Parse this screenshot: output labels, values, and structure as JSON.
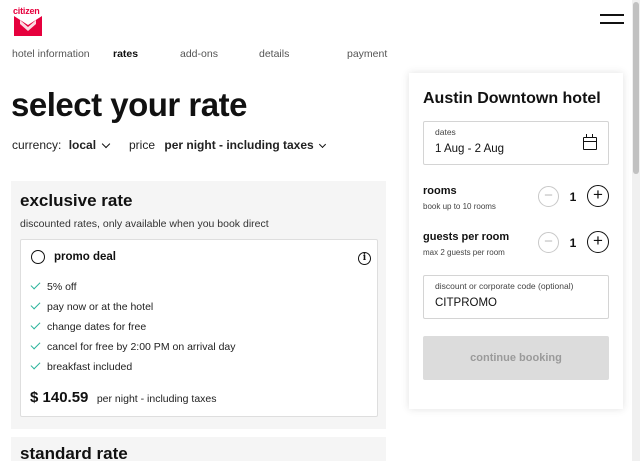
{
  "brand": {
    "logo_text": "citizen",
    "accent": "#e6003d"
  },
  "nav": {
    "steps": [
      {
        "label": "hotel information"
      },
      {
        "label": "rates",
        "active": true
      },
      {
        "label": "add-ons"
      },
      {
        "label": "details"
      },
      {
        "label": "payment"
      }
    ],
    "menu_icon": "hamburger-icon"
  },
  "page": {
    "title": "select your rate"
  },
  "filters": {
    "currency": {
      "label": "currency:",
      "value": "local"
    },
    "price": {
      "label": "price",
      "value": "per night - including taxes"
    }
  },
  "rates": [
    {
      "title": "exclusive rate",
      "subtitle": "discounted rates, only available when you book direct",
      "deal": {
        "name": "promo deal",
        "features": [
          "5% off",
          "pay now or at the hotel",
          "change dates for free",
          "cancel for free by 2:00 PM on arrival day",
          "breakfast included"
        ],
        "price": "$ 140.59",
        "price_note": "per night - including taxes",
        "check_color": "#2bb39b"
      }
    },
    {
      "title": "standard rate"
    }
  ],
  "booking": {
    "hotel_name": "Austin Downtown hotel",
    "dates": {
      "label": "dates",
      "value": "1 Aug - 2 Aug"
    },
    "rooms": {
      "label": "rooms",
      "sub": "book up to 10 rooms",
      "value": "1"
    },
    "guests": {
      "label": "guests per room",
      "sub": "max 2 guests per room",
      "value": "1"
    },
    "code": {
      "label": "discount or corporate code (optional)",
      "value": "CITPROMO"
    },
    "continue_label": "continue booking"
  }
}
